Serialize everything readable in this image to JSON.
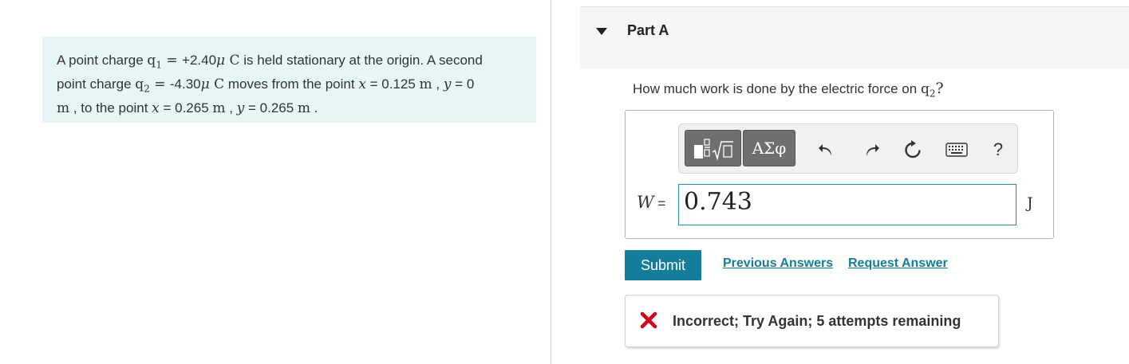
{
  "problem": {
    "t1": "A point charge ",
    "q1_label": "q",
    "q1_sub": "1",
    "eq1": " = ",
    "q1_value": "+2.40",
    "mu1": "μ",
    "unit_c1": " C",
    "t2": " is held stationary at the origin. A second",
    "t3": "point charge ",
    "q2_label": "q",
    "q2_sub": "2",
    "eq2": " = ",
    "q2_value": "-4.30",
    "mu2": "μ",
    "unit_c2": " C",
    "t4": " moves from the point ",
    "x1_var": "x",
    "x1_value": " = 0.125 ",
    "m1": "m",
    "comma1": " , ",
    "y1_var": "y",
    "y1_value": " = 0",
    "m2": "m",
    "t5": " , to the point ",
    "x2_var": "x",
    "x2_value": " = 0.265 ",
    "m3": "m",
    "comma2": " , ",
    "y2_var": "y",
    "y2_value": " = 0.265 ",
    "m4": "m",
    "t6": " ."
  },
  "part": {
    "title": "Part A"
  },
  "question": {
    "text": "How much work is done by the electric force on ",
    "q_label": "q",
    "q_sub": "2",
    "qmark": "?"
  },
  "answer": {
    "var_label": "W",
    "eq_label": " = ",
    "value": "0.743",
    "unit": "J"
  },
  "toolbar": {
    "greek_label": "ΑΣφ",
    "help_label": "?",
    "icons": [
      "templates-icon",
      "greek-symbols-icon",
      "undo-icon",
      "redo-icon",
      "reset-icon",
      "keyboard-icon",
      "help-icon"
    ]
  },
  "actions": {
    "submit_label": "Submit",
    "previous_answers_label": "Previous Answers",
    "request_answer_label": "Request Answer"
  },
  "feedback": {
    "text": "Incorrect; Try Again; 5 attempts remaining"
  },
  "colors": {
    "accent": "#137d9b",
    "problem_bg": "#e6f5f5",
    "error": "#d0021b",
    "toolbar_button": "#6f6f6f"
  }
}
